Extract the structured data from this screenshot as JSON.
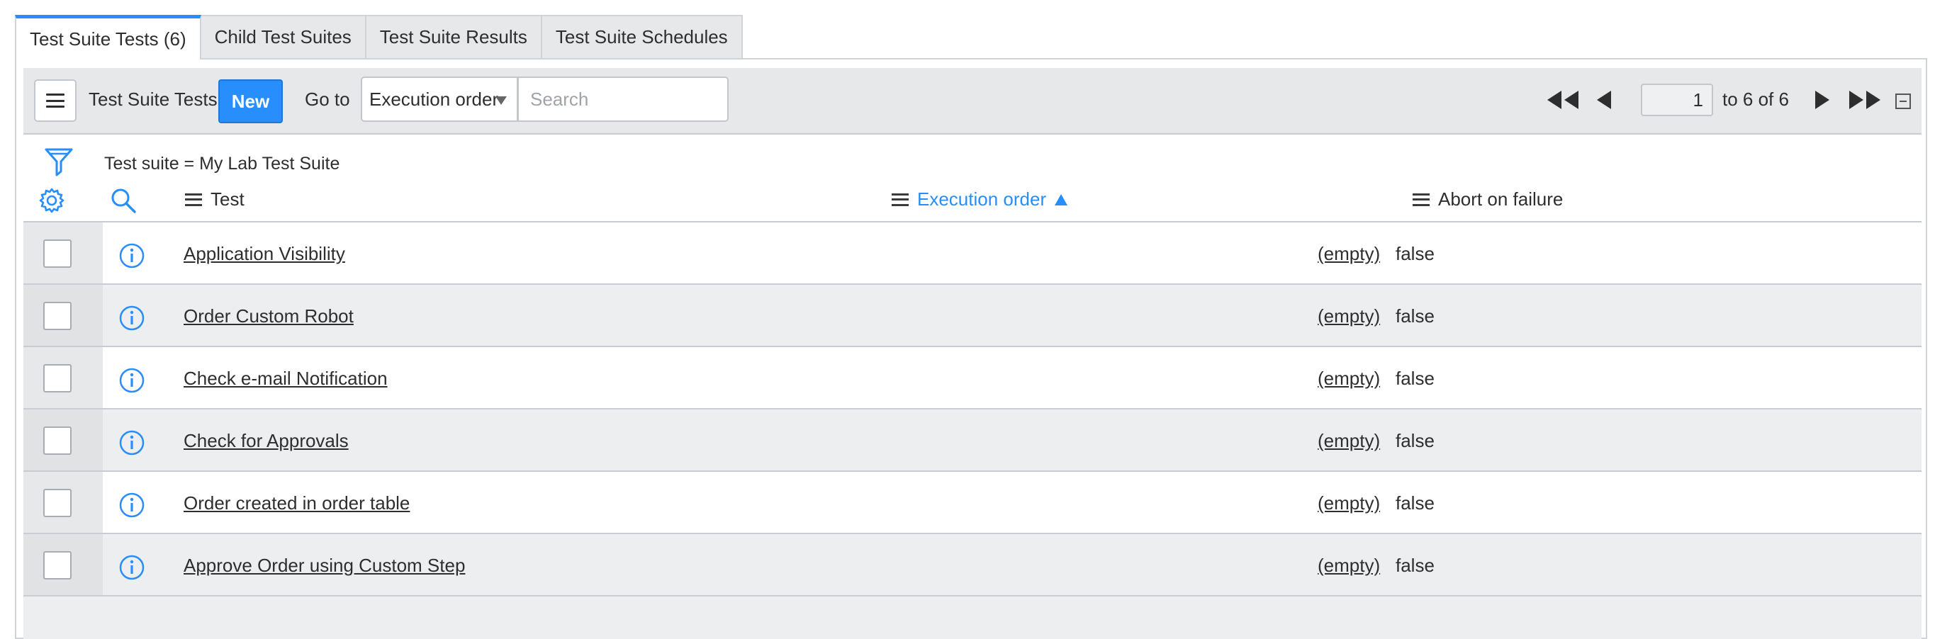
{
  "tabs": [
    {
      "label": "Test Suite Tests (6)",
      "active": true
    },
    {
      "label": "Child Test Suites",
      "active": false
    },
    {
      "label": "Test Suite Results",
      "active": false
    },
    {
      "label": "Test Suite Schedules",
      "active": false
    }
  ],
  "toolbar": {
    "menu_icon": "hamburger-icon",
    "list_title": "Test Suite Tests",
    "new_label": "New",
    "goto_label": "Go to",
    "goto_selected": "Execution order",
    "search_placeholder": "Search"
  },
  "pager": {
    "first_icon": "first-page-icon",
    "prev_icon": "previous-page-icon",
    "current_page": "1",
    "range_text": "to 6 of 6",
    "next_icon": "next-page-icon",
    "last_icon": "last-page-icon",
    "collapse_icon": "collapse-icon"
  },
  "filter": {
    "icon": "funnel-icon",
    "text": "Test suite = My Lab Test Suite"
  },
  "columns": {
    "settings_icon": "gear-icon",
    "search_icon": "search-icon",
    "test": "Test",
    "execution_order": "Execution order",
    "abort_on_failure": "Abort on failure",
    "sort_direction": "ascending"
  },
  "rows": [
    {
      "test": "Application Visibility",
      "execution_order": "(empty)",
      "abort_on_failure": "false"
    },
    {
      "test": "Order Custom Robot",
      "execution_order": "(empty)",
      "abort_on_failure": "false"
    },
    {
      "test": "Check e-mail Notification",
      "execution_order": "(empty)",
      "abort_on_failure": "false"
    },
    {
      "test": "Check for Approvals",
      "execution_order": "(empty)",
      "abort_on_failure": "false"
    },
    {
      "test": "Order created in order table",
      "execution_order": "(empty)",
      "abort_on_failure": "false"
    },
    {
      "test": "Approve Order using Custom Step",
      "execution_order": "(empty)",
      "abort_on_failure": "false"
    }
  ],
  "colors": {
    "accent": "#278efc",
    "toolbar_bg": "#e6e8ea",
    "row_alt_bg": "#eceeef",
    "text": "#2e2e2e"
  }
}
